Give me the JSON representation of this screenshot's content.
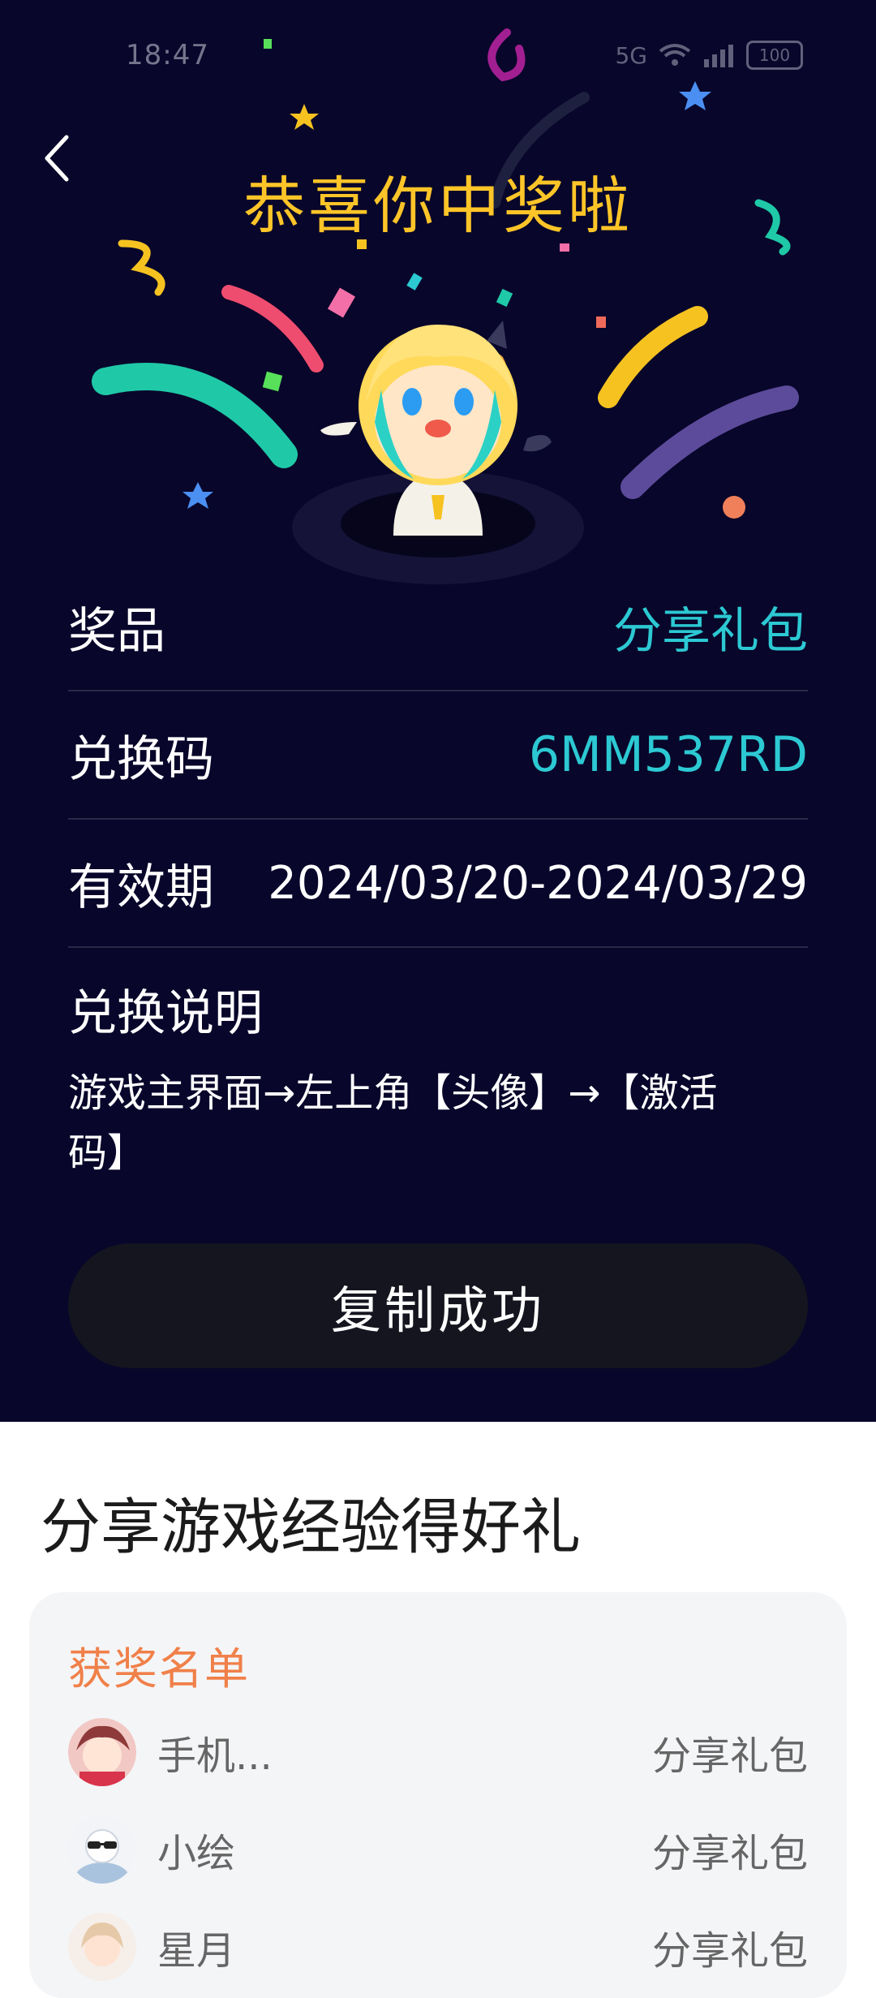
{
  "status_bar": {
    "time": "18:47",
    "network": "5G",
    "battery": "100"
  },
  "header": {
    "title": "恭喜你中奖啦"
  },
  "prize": {
    "label": "奖品",
    "value": "分享礼包"
  },
  "code": {
    "label": "兑换码",
    "value": "6MM537RD"
  },
  "validity": {
    "label": "有效期",
    "value": "2024/03/20-2024/03/29"
  },
  "instructions": {
    "title": "兑换说明",
    "text": "游戏主界面→左上角【头像】→【激活码】"
  },
  "copy_button": {
    "label": "复制成功"
  },
  "share_section": {
    "title": "分享游戏经验得好礼"
  },
  "winners": {
    "title": "获奖名单",
    "rows": [
      {
        "name": "手机...",
        "prize": "分享礼包"
      },
      {
        "name": "小绘",
        "prize": "分享礼包"
      },
      {
        "name": "星月",
        "prize": "分享礼包"
      }
    ]
  },
  "colors": {
    "background_dark": "#08062a",
    "title_gold": "#ffc528",
    "value_teal": "#2cc9d3",
    "winners_orange": "#f08049"
  }
}
